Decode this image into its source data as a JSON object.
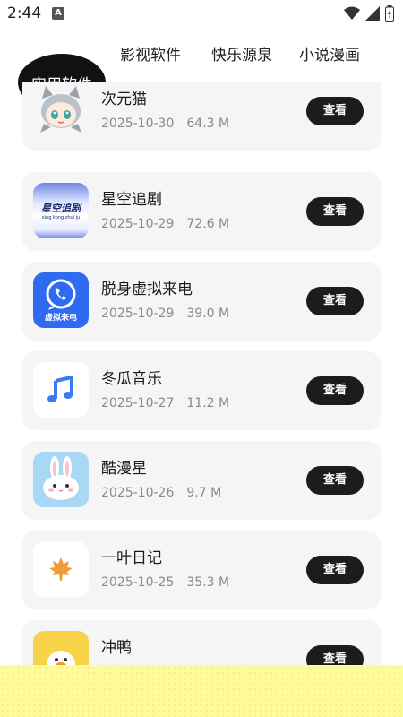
{
  "status": {
    "time": "2:44",
    "notif_letter": "A"
  },
  "tabs": [
    {
      "label": "实用软件",
      "active": true
    },
    {
      "label": "影视软件",
      "active": false
    },
    {
      "label": "快乐源泉",
      "active": false
    },
    {
      "label": "小说漫画",
      "active": false
    }
  ],
  "apps": [
    {
      "name": "次元猫",
      "date": "2025-10-30",
      "size": "64.3 M",
      "button": "查看",
      "icon": "anime-cat-icon"
    },
    {
      "name": "星空追剧",
      "date": "2025-10-29",
      "size": "72.6 M",
      "button": "查看",
      "icon": "star-sky-drama-icon",
      "icon_text": "星空追剧",
      "icon_subtext": "xing kong zhui ju"
    },
    {
      "name": "脱身虚拟来电",
      "date": "2025-10-29",
      "size": "39.0 M",
      "button": "查看",
      "icon": "phone-call-icon",
      "icon_text": "虚拟来电"
    },
    {
      "name": "冬瓜音乐",
      "date": "2025-10-27",
      "size": "11.2 M",
      "button": "查看",
      "icon": "music-note-icon"
    },
    {
      "name": "酷漫星",
      "date": "2025-10-26",
      "size": "9.7 M",
      "button": "查看",
      "icon": "bunny-icon"
    },
    {
      "name": "一叶日记",
      "date": "2025-10-25",
      "size": "35.3 M",
      "button": "查看",
      "icon": "maple-leaf-icon"
    },
    {
      "name": "冲鸭",
      "date": "",
      "size": "",
      "button": "查看",
      "icon": "duck-icon"
    }
  ],
  "colors": {
    "accent": "#111111",
    "card_bg": "#f5f5f5",
    "meta_text": "#8a8a8a",
    "phone_blue": "#2f6bf0",
    "music_blue": "#3a7cf0",
    "leaf_orange": "#f29a3a"
  }
}
